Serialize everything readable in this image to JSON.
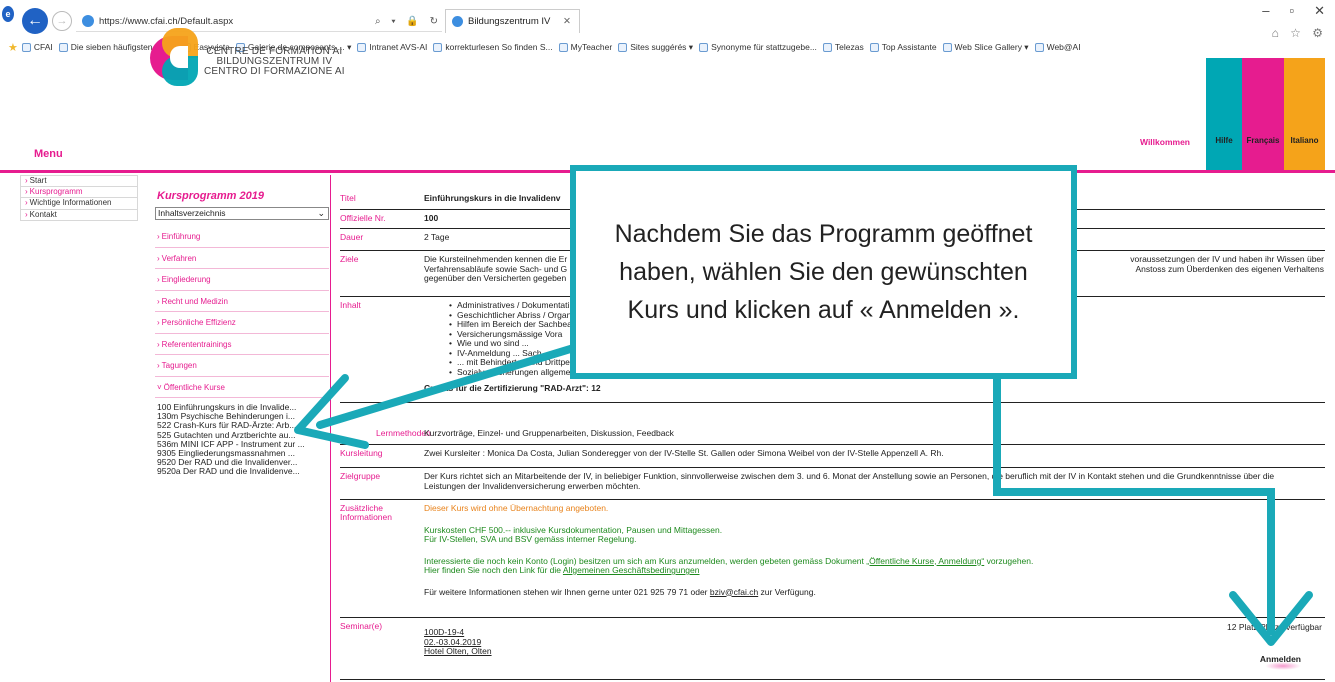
{
  "browser": {
    "url": "https://www.cfai.ch/Default.aspx",
    "address_controls": "⌕ ▾ 🔒 ↻",
    "tab_title": "Bildungszentrum IV",
    "window_controls": [
      "–",
      "▫",
      "✕"
    ],
    "right_icons": "⌂ ☆ ⚙",
    "favorites": [
      "CFAI",
      "Die sieben häufigsten Typ...",
      "Easyvista",
      "Galerie de composants ... ▾",
      "Intranet AVS-AI",
      "korrekturlesen So finden S...",
      "MyTeacher",
      "Sites suggérés ▾",
      "Synonyme für stattzugebe... ",
      "Telezas",
      "Top Assistante",
      "Web Slice Gallery ▾",
      "Web@AI"
    ]
  },
  "header": {
    "logo_lines": [
      "CENTRE DE FORMATION AI",
      "BILDUNGSZENTRUM IV",
      "CENTRO DI FORMAZIONE AI"
    ],
    "menu_title": "Menu",
    "welcome": "Willkommen",
    "lang_help": "Hilfe",
    "lang_fr": "Français",
    "lang_it": "Italiano"
  },
  "left_menu": [
    "Start",
    "Kursprogramm",
    "Wichtige Informationen",
    "Kontakt"
  ],
  "program": {
    "title": "Kursprogramm 2019",
    "select_value": "Inhaltsverzeichnis",
    "categories": [
      "Einführung",
      "Verfahren",
      "Eingliederung",
      "Recht und Medizin",
      "Persönliche Effizienz",
      "Referententrainings",
      "Tagungen",
      "Öffentliche Kurse"
    ],
    "courses": [
      "100 Einführungskurs in die Invalide...",
      "130m Psychische Behinderungen i...",
      "522 Crash-Kurs für RAD-Ärzte: Arb...",
      "525 Gutachten und Arztberichte au...",
      "536m MINI ICF APP - Instrument zur ...",
      "9305 Eingliederungsmassnahmen ...",
      "9520 Der RAD und die Invalidenver...",
      "9520a Der RAD und die Invalidenve..."
    ]
  },
  "detail": {
    "titel_label": "Titel",
    "titel_value": "Einführungskurs in die Invalidenv",
    "nr_label": "Offizielle Nr.",
    "nr_value": "100",
    "dauer_label": "Dauer",
    "dauer_value": "2 Tage",
    "ziele_label": "Ziele",
    "ziele_line1_left": "Die Kursteilnehmenden kennen die Er",
    "ziele_line1_right": "voraussetzungen der IV und haben ihr Wissen über",
    "ziele_line2_left": "Verfahrensabläufe sowie Sach- und G",
    "ziele_line2_right": "Anstoss zum Überdenken des eigenen Verhaltens",
    "ziele_line3": "gegenüber den Versicherten gegeben",
    "inhalt_label": "Inhalt",
    "inhalt_items": [
      "Administratives / Dokumentati",
      "Geschichtlicher Abriss / Organ",
      "Hilfen im Bereich der Sachbear",
      "Versicherungsmässige Vora",
      "Wie und wo sind ...",
      "IV-Anmeldung ... Sach",
      "... mit Behinderten und Drittpersonen / Schweigepflicht / Akteneinsicht",
      "Sozialversicherungen allgemein / Positionierung der IV / 3.-Säulen-Konzeption"
    ],
    "credits": "Credits für die Zertifizierung \"RAD-Arzt\": 12",
    "methoden_label": "Lernmethoden",
    "methoden_value": "Kurzvorträge, Einzel- und Gruppenarbeiten, Diskussion, Feedback",
    "kursleitung_label": "Kursleitung",
    "kursleitung_value": "Zwei Kursleiter : Monica Da Costa, Julian Sonderegger von der IV-Stelle St. Gallen oder Simona Weibel von der IV-Stelle Appenzell A. Rh.",
    "zielgruppe_label": "Zielgruppe",
    "zielgruppe_line1": "Der Kurs richtet sich an Mitarbeitende der IV, in beliebiger Funktion, sinnvollerweise zwischen dem 3. und 6. Monat der Anstellung sowie an Personen, die beruflich mit der IV in Kontakt stehen und die Grundkenntnisse über die",
    "zielgruppe_line2": "Leistungen der Invalidenversicherung erwerben möchten.",
    "zusatz_label": "Zusätzliche Informationen",
    "zusatz_orange": "Dieser Kurs wird ohne Übernachtung angeboten.",
    "zusatz_kosten": "Kurskosten CHF 500.-- inklusive Kursdokumentation, Pausen und Mittagessen.",
    "zusatz_regel": "Für IV-Stellen, SVA und BSV gemäss interner Regelung.",
    "zusatz_konto_pre": "Interessierte die noch kein Konto (Login) besitzen um sich am Kurs anzumelden, werden gebeten gemäss Dokument ",
    "zusatz_konto_link": "„Öffentliche Kurse, Anmeldung“",
    "zusatz_konto_post": " vorzugehen.",
    "zusatz_agb_pre": "Hier finden Sie noch den Link für die ",
    "zusatz_agb_link": "Allgemeinen Geschäftsbedingungen",
    "zusatz_kontakt_pre": "Für weitere Informationen stehen wir Ihnen gerne unter 021 925 79 71 oder ",
    "zusatz_kontakt_link": "bziv@cfai.ch",
    "zusatz_kontakt_post": " zur Verfügung.",
    "seminar_label": "Seminar(e)",
    "seminar_code": "100D-19-4",
    "seminar_date": "02.-03.04.2019",
    "seminar_place": "Hotel Olten, Olten",
    "seminar_status": "12 Platz/Plätze verfügbar",
    "anmelden": "Anmelden"
  },
  "callout": {
    "text": "Nachdem Sie das Programm geöffnet haben, wählen Sie den gewünschten Kurs und klicken auf « Anmelden »."
  },
  "colors": {
    "brand_pink": "#e61c8f",
    "brand_teal": "#00a7b4",
    "brand_orange": "#f5a31a",
    "annotation_teal": "#1aa9b8"
  }
}
